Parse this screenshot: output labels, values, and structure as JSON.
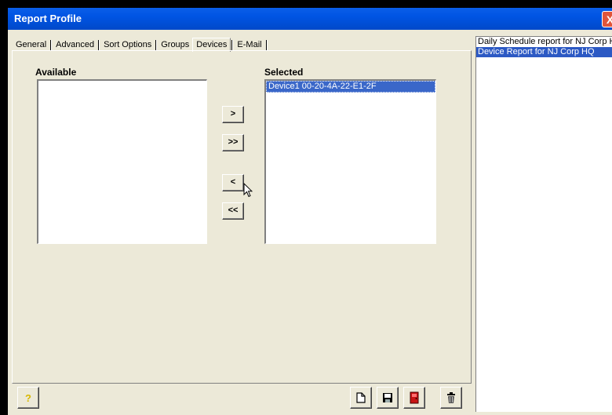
{
  "window": {
    "title": "Report Profile",
    "close_label": "X"
  },
  "tabs": [
    {
      "label": "General"
    },
    {
      "label": "Advanced"
    },
    {
      "label": "Sort Options"
    },
    {
      "label": "Groups"
    },
    {
      "label": "Devices",
      "active": true
    },
    {
      "label": "E-Mail"
    }
  ],
  "devices": {
    "available_label": "Available",
    "selected_label": "Selected",
    "available_items": [],
    "selected_items": [
      "Device1 00-20-4A-22-E1-2F"
    ],
    "buttons": {
      "add_one": ">",
      "add_all": ">>",
      "remove_one": "<",
      "remove_all": "<<"
    }
  },
  "toolbar": {
    "help_label": "?",
    "icons": [
      "new-document-icon",
      "save-icon",
      "exit-door-icon",
      "trash-icon"
    ]
  },
  "reports": {
    "items": [
      "Daily Schedule report for NJ Corp HQ",
      "Device Report for NJ Corp HQ"
    ],
    "selected_index": 1
  },
  "colors": {
    "titlebar": "#0054e3",
    "selection": "#2c59c4",
    "face": "#ece9d8",
    "help_icon": "#e8c800",
    "exit_icon": "#c81414"
  }
}
